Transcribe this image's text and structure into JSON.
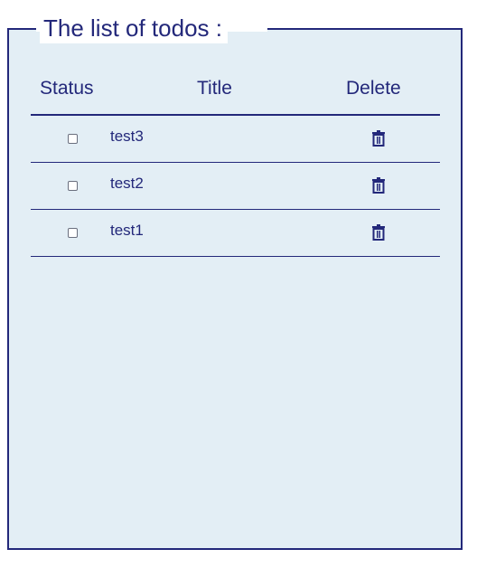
{
  "legend": "The list of todos :",
  "columns": {
    "status": "Status",
    "title": "Title",
    "delete": "Delete"
  },
  "todos": [
    {
      "title": "test3",
      "done": false
    },
    {
      "title": "test2",
      "done": false
    },
    {
      "title": "test1",
      "done": false
    }
  ],
  "colors": {
    "accent": "#23287a",
    "panel_bg": "#e3eef5"
  },
  "icons": {
    "delete": "trash-icon"
  }
}
